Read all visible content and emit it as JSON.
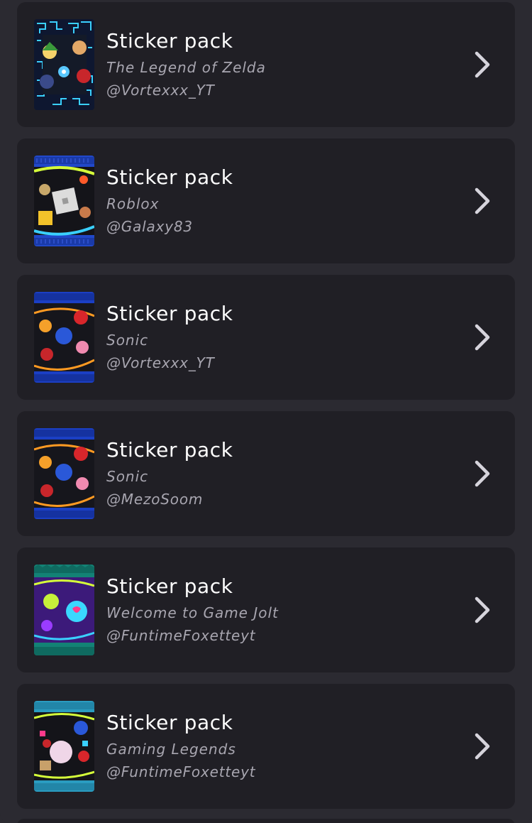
{
  "items": [
    {
      "title": "Sticker pack",
      "game": "The Legend of Zelda",
      "author": "@Vortexxx_YT",
      "pack_art": "zelda-pack-art",
      "colors": {
        "wrapper": "#0e1730",
        "accent": "#3ad0ff"
      }
    },
    {
      "title": "Sticker pack",
      "game": "Roblox",
      "author": "@Galaxy83",
      "pack_art": "roblox-pack-art",
      "colors": {
        "wrapper": "#2148c9",
        "accent": "#d6ff3a"
      }
    },
    {
      "title": "Sticker pack",
      "game": "Sonic",
      "author": "@Vortexxx_YT",
      "pack_art": "sonic-pack-art",
      "colors": {
        "wrapper": "#1b3fc4",
        "accent": "#ff9a22"
      }
    },
    {
      "title": "Sticker pack",
      "game": "Sonic",
      "author": "@MezoSoom",
      "pack_art": "sonic-pack-art",
      "colors": {
        "wrapper": "#1b3fc4",
        "accent": "#ff9a22"
      }
    },
    {
      "title": "Sticker pack",
      "game": "Welcome to Game Jolt",
      "author": "@FuntimeFoxetteyt",
      "pack_art": "gamejolt-pack-art",
      "colors": {
        "wrapper": "#138275",
        "accent": "#7a3cff"
      }
    },
    {
      "title": "Sticker pack",
      "game": "Gaming Legends",
      "author": "@FuntimeFoxetteyt",
      "pack_art": "legends-pack-art",
      "colors": {
        "wrapper": "#2a9cc0",
        "accent": "#d6ff3a"
      }
    }
  ],
  "row_action_icon": "chevron-right-icon"
}
